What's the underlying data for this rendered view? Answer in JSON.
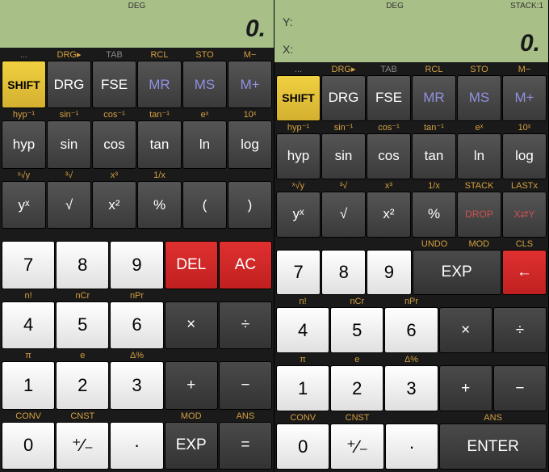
{
  "left": {
    "status": {
      "deg": "DEG"
    },
    "display": "0.",
    "row1": [
      {
        "sec": "...",
        "btn": "SHIFT",
        "secClass": "gray",
        "btnClass": "shift"
      },
      {
        "sec": "DRG▸",
        "btn": "DRG",
        "secClass": "orange"
      },
      {
        "sec": "TAB",
        "btn": "FSE",
        "secClass": "gray"
      },
      {
        "sec": "RCL",
        "btn": "MR",
        "secClass": "orange",
        "btnClass": "purple"
      },
      {
        "sec": "STO",
        "btn": "MS",
        "secClass": "orange",
        "btnClass": "purple"
      },
      {
        "sec": "M−",
        "btn": "M+",
        "secClass": "orange",
        "btnClass": "purple"
      }
    ],
    "row2": [
      {
        "sec": "hyp⁻¹",
        "btn": "hyp",
        "secClass": "orange"
      },
      {
        "sec": "sin⁻¹",
        "btn": "sin",
        "secClass": "orange"
      },
      {
        "sec": "cos⁻¹",
        "btn": "cos",
        "secClass": "orange"
      },
      {
        "sec": "tan⁻¹",
        "btn": "tan",
        "secClass": "orange"
      },
      {
        "sec": "eˣ",
        "btn": "ln",
        "secClass": "orange"
      },
      {
        "sec": "10ˣ",
        "btn": "log",
        "secClass": "orange"
      }
    ],
    "row3": [
      {
        "sec": "ˣ√y",
        "btn": "yˣ",
        "secClass": "orange"
      },
      {
        "sec": "³√",
        "btn": "√",
        "secClass": "orange"
      },
      {
        "sec": "x³",
        "btn": "x²",
        "secClass": "orange"
      },
      {
        "sec": "1/x",
        "btn": "%",
        "secClass": "orange"
      },
      {
        "sec": "",
        "btn": "("
      },
      {
        "sec": "",
        "btn": ")"
      }
    ],
    "row4": [
      {
        "sec": "",
        "btn": "7",
        "btnClass": "white"
      },
      {
        "sec": "",
        "btn": "8",
        "btnClass": "white"
      },
      {
        "sec": "",
        "btn": "9",
        "btnClass": "white"
      },
      {
        "sec": "",
        "btn": "DEL",
        "btnClass": "red"
      },
      {
        "sec": "",
        "btn": "AC",
        "btnClass": "red"
      }
    ],
    "row5": [
      {
        "sec": "n!",
        "btn": "4",
        "secClass": "orange",
        "btnClass": "white"
      },
      {
        "sec": "nCr",
        "btn": "5",
        "secClass": "orange",
        "btnClass": "white"
      },
      {
        "sec": "nPr",
        "btn": "6",
        "secClass": "orange",
        "btnClass": "white"
      },
      {
        "sec": "",
        "btn": "×",
        "btnClass": "dark"
      },
      {
        "sec": "",
        "btn": "÷",
        "btnClass": "dark"
      }
    ],
    "row6": [
      {
        "sec": "π",
        "btn": "1",
        "secClass": "orange",
        "btnClass": "white"
      },
      {
        "sec": "e",
        "btn": "2",
        "secClass": "orange",
        "btnClass": "white"
      },
      {
        "sec": "Δ%",
        "btn": "3",
        "secClass": "orange",
        "btnClass": "white"
      },
      {
        "sec": "",
        "btn": "+",
        "btnClass": "dark"
      },
      {
        "sec": "",
        "btn": "−",
        "btnClass": "dark"
      }
    ],
    "row7": [
      {
        "sec": "CONV",
        "btn": "0",
        "secClass": "orange",
        "btnClass": "white"
      },
      {
        "sec": "CNST",
        "btn": "⁺∕₋",
        "secClass": "orange",
        "btnClass": "white"
      },
      {
        "sec": "",
        "btn": "·",
        "btnClass": "white"
      },
      {
        "sec": "MOD",
        "btn": "EXP",
        "secClass": "orange",
        "btnClass": "dark"
      },
      {
        "sec": "ANS",
        "btn": "=",
        "secClass": "orange",
        "btnClass": "dark"
      }
    ]
  },
  "right": {
    "status": {
      "deg": "DEG",
      "stack": "STACK:1"
    },
    "displayY": "Y:",
    "displayX": "X:",
    "displayVal": "0.",
    "row1": [
      {
        "sec": "...",
        "btn": "SHIFT",
        "secClass": "gray",
        "btnClass": "shift"
      },
      {
        "sec": "DRG▸",
        "btn": "DRG",
        "secClass": "orange"
      },
      {
        "sec": "TAB",
        "btn": "FSE",
        "secClass": "gray"
      },
      {
        "sec": "RCL",
        "btn": "MR",
        "secClass": "orange",
        "btnClass": "purple"
      },
      {
        "sec": "STO",
        "btn": "MS",
        "secClass": "orange",
        "btnClass": "purple"
      },
      {
        "sec": "M−",
        "btn": "M+",
        "secClass": "orange",
        "btnClass": "purple"
      }
    ],
    "row2": [
      {
        "sec": "hyp⁻¹",
        "btn": "hyp",
        "secClass": "orange"
      },
      {
        "sec": "sin⁻¹",
        "btn": "sin",
        "secClass": "orange"
      },
      {
        "sec": "cos⁻¹",
        "btn": "cos",
        "secClass": "orange"
      },
      {
        "sec": "tan⁻¹",
        "btn": "tan",
        "secClass": "orange"
      },
      {
        "sec": "eˣ",
        "btn": "ln",
        "secClass": "orange"
      },
      {
        "sec": "10ˣ",
        "btn": "log",
        "secClass": "orange"
      }
    ],
    "row3": [
      {
        "sec": "ˣ√y",
        "btn": "yˣ",
        "secClass": "orange"
      },
      {
        "sec": "³√",
        "btn": "√",
        "secClass": "orange"
      },
      {
        "sec": "x³",
        "btn": "x²",
        "secClass": "orange"
      },
      {
        "sec": "1/x",
        "btn": "%",
        "secClass": "orange"
      },
      {
        "sec": "STACK",
        "btn": "DROP",
        "secClass": "orange",
        "btnRed": true,
        "btnClass": "small"
      },
      {
        "sec": "LASTx",
        "btn": "X⇄Y",
        "secClass": "orange",
        "btnRed": true,
        "btnClass": "small"
      }
    ],
    "row4": [
      {
        "sec": "",
        "btn": "7",
        "btnClass": "white"
      },
      {
        "sec": "",
        "btn": "8",
        "btnClass": "white"
      },
      {
        "sec": "",
        "btn": "9",
        "btnClass": "white"
      },
      {
        "sec": "UNDO",
        "btn": "EXP",
        "secClass": "orange",
        "btnClass": "dark",
        "span": 1
      },
      {
        "sec": "MOD",
        "btn": "",
        "secHidden": true
      },
      {
        "sec": "CLS",
        "btn": "←",
        "secClass": "orange",
        "btnClass": "red arrow"
      }
    ],
    "row5": [
      {
        "sec": "n!",
        "btn": "4",
        "secClass": "orange",
        "btnClass": "white"
      },
      {
        "sec": "nCr",
        "btn": "5",
        "secClass": "orange",
        "btnClass": "white"
      },
      {
        "sec": "nPr",
        "btn": "6",
        "secClass": "orange",
        "btnClass": "white"
      },
      {
        "sec": "",
        "btn": "×",
        "btnClass": "dark"
      },
      {
        "sec": "",
        "btn": "÷",
        "btnClass": "dark"
      }
    ],
    "row6": [
      {
        "sec": "π",
        "btn": "1",
        "secClass": "orange",
        "btnClass": "white"
      },
      {
        "sec": "e",
        "btn": "2",
        "secClass": "orange",
        "btnClass": "white"
      },
      {
        "sec": "Δ%",
        "btn": "3",
        "secClass": "orange",
        "btnClass": "white"
      },
      {
        "sec": "",
        "btn": "+",
        "btnClass": "dark"
      },
      {
        "sec": "",
        "btn": "−",
        "btnClass": "dark"
      }
    ],
    "row7": [
      {
        "sec": "CONV",
        "btn": "0",
        "secClass": "orange",
        "btnClass": "white"
      },
      {
        "sec": "CNST",
        "btn": "⁺∕₋",
        "secClass": "orange",
        "btnClass": "white"
      },
      {
        "sec": "",
        "btn": "·",
        "btnClass": "white"
      },
      {
        "sec": "ANS",
        "btn": "ENTER",
        "secClass": "orange",
        "btnClass": "dark",
        "span": 2
      }
    ]
  }
}
